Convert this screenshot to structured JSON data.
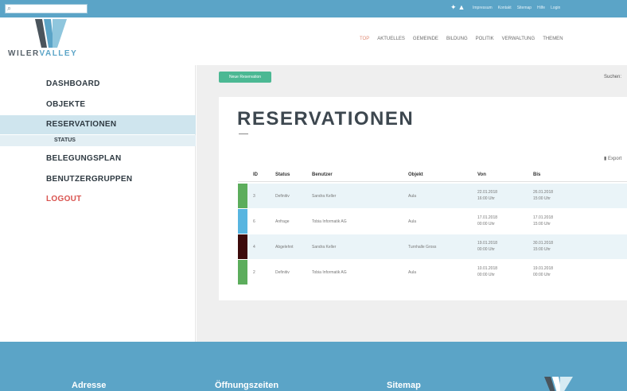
{
  "colors": {
    "accent": "#5ba4c7",
    "new_button": "#4bb893",
    "logout": "#d9534f",
    "status_green": "#5cad5c",
    "status_blue": "#58b5e0",
    "status_darkred": "#3c0a0a"
  },
  "topbar": {
    "search_icon": "search-icon",
    "links": [
      "Impressum",
      "Kontakt",
      "Sitemap",
      "Hilfe",
      "Login"
    ]
  },
  "header": {
    "logo_text_1": "WILER",
    "logo_text_2": "VALLEY",
    "nav": [
      "TOP",
      "AKTUELLES",
      "GEMEINDE",
      "BILDUNG",
      "POLITIK",
      "VERWALTUNG",
      "THEMEN"
    ]
  },
  "sidebar": {
    "items": [
      "DASHBOARD",
      "OBJEKTE",
      "RESERVATIONEN",
      "STATUS",
      "BELEGUNGSPLAN",
      "BENUTZERGRUPPEN",
      "LOGOUT"
    ]
  },
  "main": {
    "new_button": "Neue Reservation",
    "search_label": "Suchen:",
    "title": "RESERVATIONEN",
    "export_label": "Export",
    "table": {
      "headers": [
        "ID",
        "Status",
        "Benutzer",
        "Objekt",
        "Von",
        "Bis"
      ],
      "rows": [
        {
          "id": "3",
          "status": "Definitiv",
          "user": "Sandra Keller",
          "object": "Aula",
          "from_date": "22.01.2018",
          "from_time": "16:00 Uhr",
          "to_date": "26.01.2018",
          "to_time": "15:00 Uhr",
          "color": "#5cad5c"
        },
        {
          "id": "6",
          "status": "Anfrage",
          "user": "Tobia Informatik AG",
          "object": "Aula",
          "from_date": "17.01.2018",
          "from_time": "00:00 Uhr",
          "to_date": "17.01.2018",
          "to_time": "15:00 Uhr",
          "color": "#58b5e0"
        },
        {
          "id": "4",
          "status": "Abgelehnt",
          "user": "Sandra Keller",
          "object": "Turnhalle Gross",
          "from_date": "19.01.2018",
          "from_time": "00:00 Uhr",
          "to_date": "30.01.2018",
          "to_time": "15:00 Uhr",
          "color": "#3c0a0a"
        },
        {
          "id": "2",
          "status": "Definitiv",
          "user": "Tobia Informatik AG",
          "object": "Aula",
          "from_date": "10.01.2018",
          "from_time": "00:00 Uhr",
          "to_date": "19.01.2018",
          "to_time": "00:00 Uhr",
          "color": "#5cad5c"
        }
      ]
    }
  },
  "footer": {
    "adresse": "Adresse",
    "oeffnungszeiten": "Öffnungszeiten",
    "sitemap": "Sitemap"
  }
}
